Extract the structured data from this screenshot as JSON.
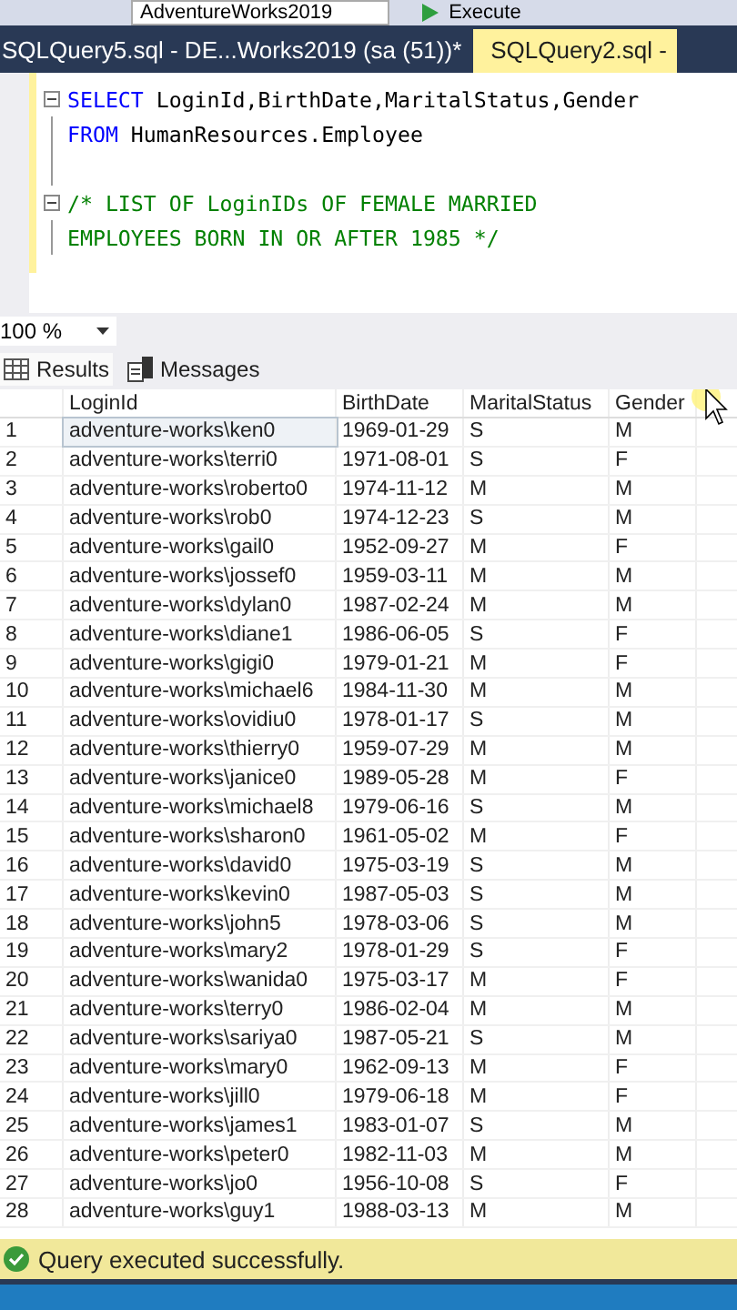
{
  "toolbar": {
    "database": "AdventureWorks2019",
    "execute": "Execute"
  },
  "tabs": [
    {
      "label": "SQLQuery5.sql - DE...Works2019 (sa (51))*",
      "selected": false
    },
    {
      "label": "SQLQuery2.sql -",
      "selected": true
    }
  ],
  "editor": {
    "lines": [
      {
        "kind": "code",
        "collapsible": true,
        "tokens": [
          {
            "text": "SELECT",
            "kind": "keyword"
          },
          {
            "text": " LoginId,BirthDate,MaritalStatus,Gender",
            "kind": "plain"
          }
        ]
      },
      {
        "kind": "code",
        "collapsible": false,
        "tokens": [
          {
            "text": "FROM",
            "kind": "keyword"
          },
          {
            "text": " HumanResources.Employee",
            "kind": "plain"
          }
        ]
      },
      {
        "kind": "blank",
        "collapsible": false
      },
      {
        "kind": "code",
        "collapsible": true,
        "tokens": [
          {
            "text": "/* LIST OF LoginIDs OF FEMALE MARRIED",
            "kind": "comment"
          }
        ]
      },
      {
        "kind": "code",
        "collapsible": false,
        "tokens": [
          {
            "text": "EMPLOYEES BORN IN OR AFTER 1985 */",
            "kind": "comment"
          }
        ]
      }
    ]
  },
  "zoom": "100 %",
  "result_tabs": [
    {
      "label": "Results",
      "selected": true
    },
    {
      "label": "Messages",
      "selected": false
    }
  ],
  "table": {
    "columns": [
      "LoginId",
      "BirthDate",
      "MaritalStatus",
      "Gender"
    ],
    "rows": [
      {
        "n": "1",
        "cells": [
          "adventure-works\\ken0",
          "1969-01-29",
          "S",
          "M"
        ],
        "selected": true
      },
      {
        "n": "2",
        "cells": [
          "adventure-works\\terri0",
          "1971-08-01",
          "S",
          "F"
        ],
        "selected": false
      },
      {
        "n": "3",
        "cells": [
          "adventure-works\\roberto0",
          "1974-11-12",
          "M",
          "M"
        ],
        "selected": false
      },
      {
        "n": "4",
        "cells": [
          "adventure-works\\rob0",
          "1974-12-23",
          "S",
          "M"
        ],
        "selected": false
      },
      {
        "n": "5",
        "cells": [
          "adventure-works\\gail0",
          "1952-09-27",
          "M",
          "F"
        ],
        "selected": false
      },
      {
        "n": "6",
        "cells": [
          "adventure-works\\jossef0",
          "1959-03-11",
          "M",
          "M"
        ],
        "selected": false
      },
      {
        "n": "7",
        "cells": [
          "adventure-works\\dylan0",
          "1987-02-24",
          "M",
          "M"
        ],
        "selected": false
      },
      {
        "n": "8",
        "cells": [
          "adventure-works\\diane1",
          "1986-06-05",
          "S",
          "F"
        ],
        "selected": false
      },
      {
        "n": "9",
        "cells": [
          "adventure-works\\gigi0",
          "1979-01-21",
          "M",
          "F"
        ],
        "selected": false
      },
      {
        "n": "10",
        "cells": [
          "adventure-works\\michael6",
          "1984-11-30",
          "M",
          "M"
        ],
        "selected": false
      },
      {
        "n": "11",
        "cells": [
          "adventure-works\\ovidiu0",
          "1978-01-17",
          "S",
          "M"
        ],
        "selected": false
      },
      {
        "n": "12",
        "cells": [
          "adventure-works\\thierry0",
          "1959-07-29",
          "M",
          "M"
        ],
        "selected": false
      },
      {
        "n": "13",
        "cells": [
          "adventure-works\\janice0",
          "1989-05-28",
          "M",
          "F"
        ],
        "selected": false
      },
      {
        "n": "14",
        "cells": [
          "adventure-works\\michael8",
          "1979-06-16",
          "S",
          "M"
        ],
        "selected": false
      },
      {
        "n": "15",
        "cells": [
          "adventure-works\\sharon0",
          "1961-05-02",
          "M",
          "F"
        ],
        "selected": false
      },
      {
        "n": "16",
        "cells": [
          "adventure-works\\david0",
          "1975-03-19",
          "S",
          "M"
        ],
        "selected": false
      },
      {
        "n": "17",
        "cells": [
          "adventure-works\\kevin0",
          "1987-05-03",
          "S",
          "M"
        ],
        "selected": false
      },
      {
        "n": "18",
        "cells": [
          "adventure-works\\john5",
          "1978-03-06",
          "S",
          "M"
        ],
        "selected": false
      },
      {
        "n": "19",
        "cells": [
          "adventure-works\\mary2",
          "1978-01-29",
          "S",
          "F"
        ],
        "selected": false
      },
      {
        "n": "20",
        "cells": [
          "adventure-works\\wanida0",
          "1975-03-17",
          "M",
          "F"
        ],
        "selected": false
      },
      {
        "n": "21",
        "cells": [
          "adventure-works\\terry0",
          "1986-02-04",
          "M",
          "M"
        ],
        "selected": false
      },
      {
        "n": "22",
        "cells": [
          "adventure-works\\sariya0",
          "1987-05-21",
          "S",
          "M"
        ],
        "selected": false
      },
      {
        "n": "23",
        "cells": [
          "adventure-works\\mary0",
          "1962-09-13",
          "M",
          "F"
        ],
        "selected": false
      },
      {
        "n": "24",
        "cells": [
          "adventure-works\\jill0",
          "1979-06-18",
          "M",
          "F"
        ],
        "selected": false
      },
      {
        "n": "25",
        "cells": [
          "adventure-works\\james1",
          "1983-01-07",
          "S",
          "M"
        ],
        "selected": false
      },
      {
        "n": "26",
        "cells": [
          "adventure-works\\peter0",
          "1982-11-03",
          "M",
          "M"
        ],
        "selected": false
      },
      {
        "n": "27",
        "cells": [
          "adventure-works\\jo0",
          "1956-10-08",
          "S",
          "F"
        ],
        "selected": false
      },
      {
        "n": "28",
        "cells": [
          "adventure-works\\guy1",
          "1988-03-13",
          "M",
          "M"
        ],
        "selected": false
      }
    ]
  },
  "status_bar": {
    "message": "Query executed successfully."
  }
}
